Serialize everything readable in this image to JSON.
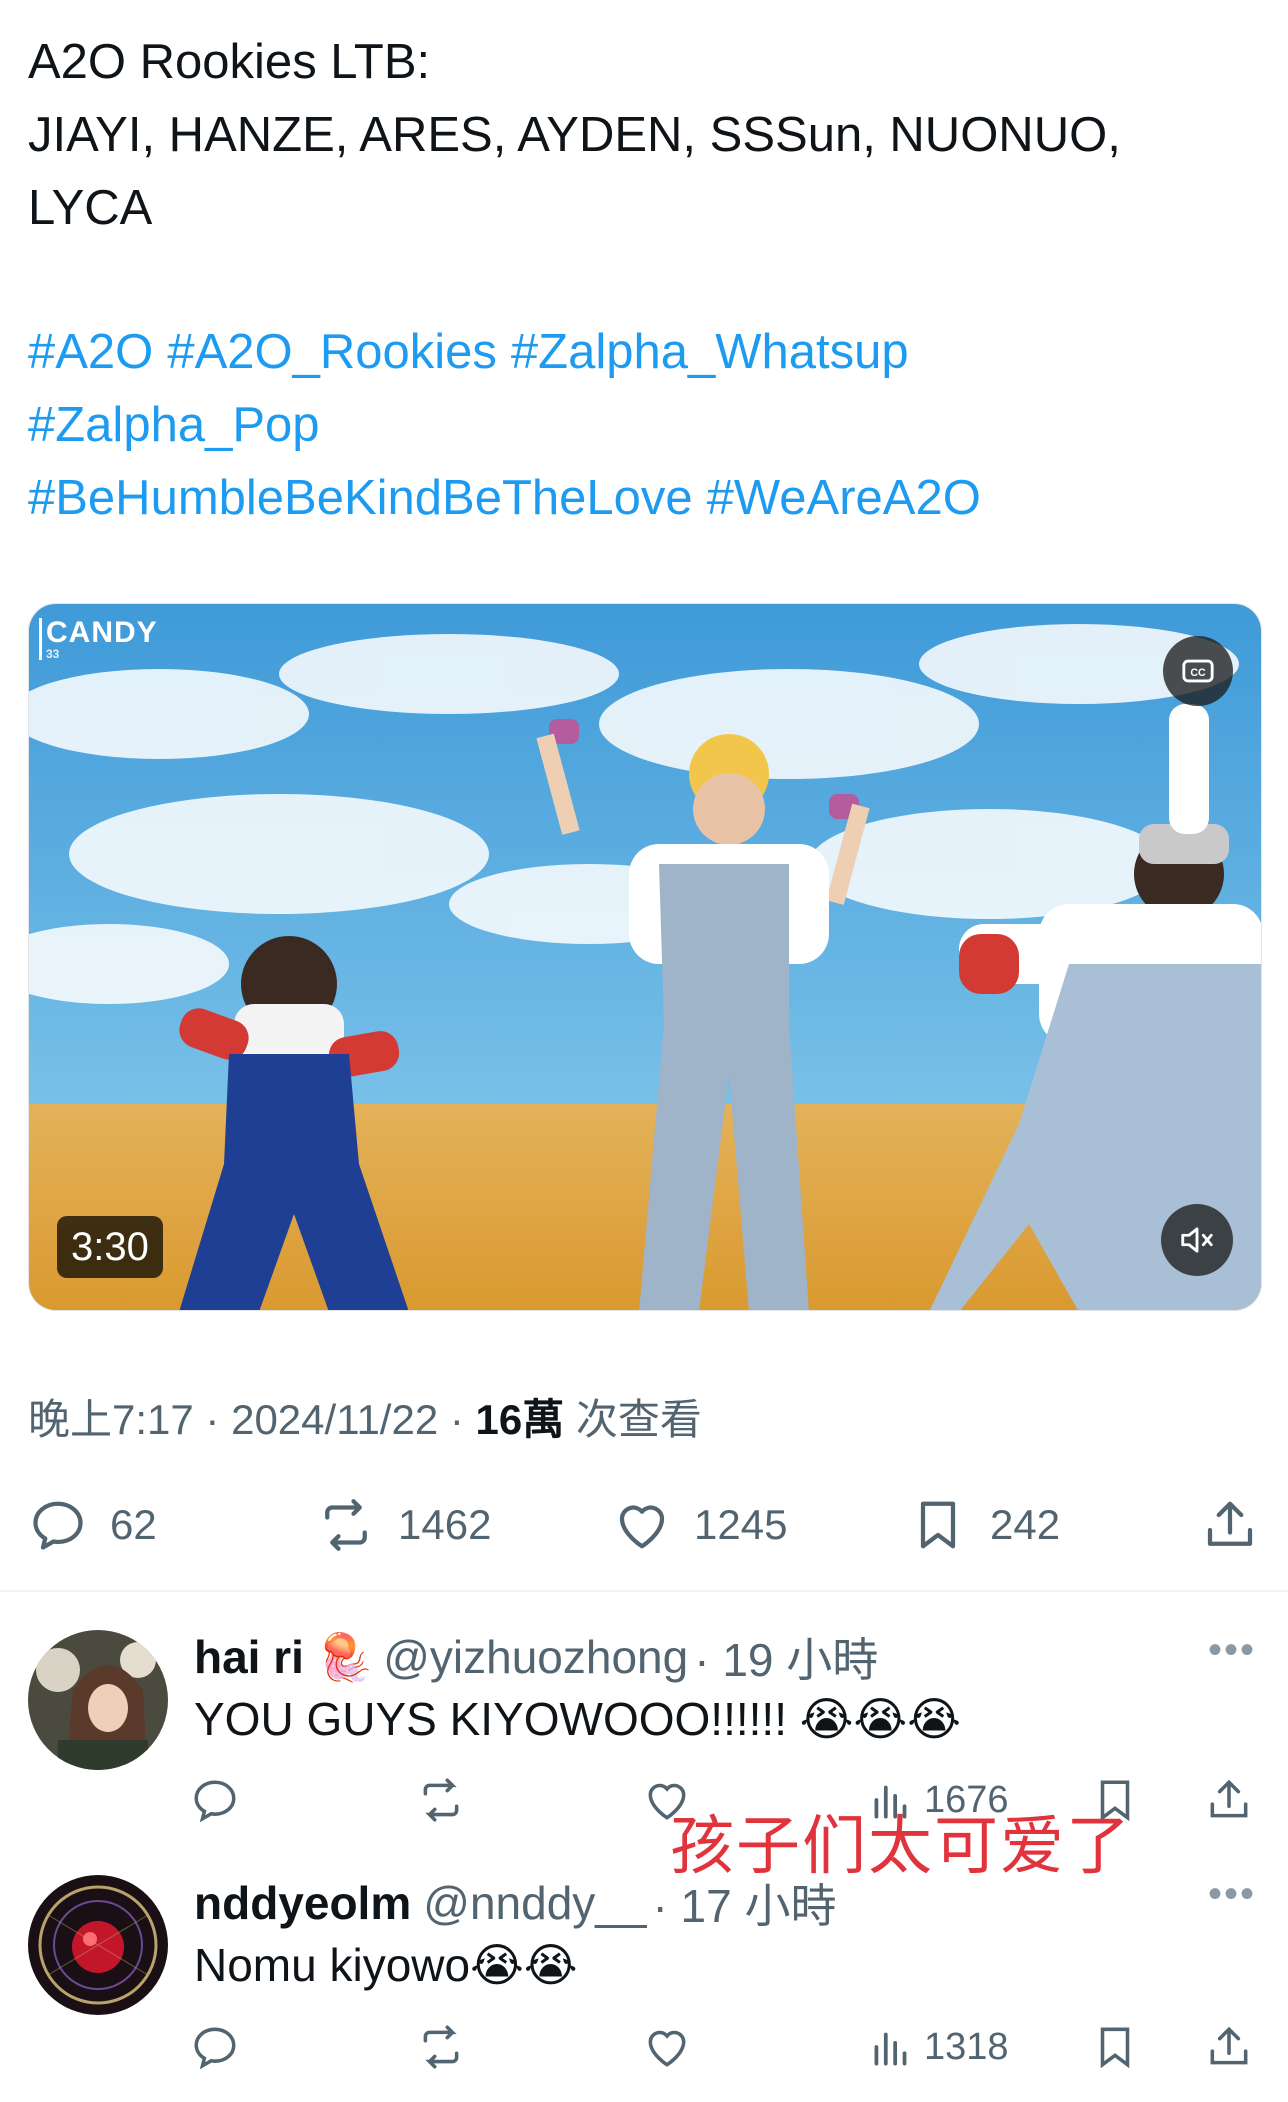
{
  "tweet": {
    "text_line1": "A2O Rookies LTB:",
    "text_line2": "JIAYI, HANZE, ARES, AYDEN, SSSun, NUONUO,",
    "text_line3": "LYCA",
    "hashtags_row1": [
      "#A2O",
      "#A2O_Rookies",
      "#Zalpha_Whatsup"
    ],
    "hashtags_row2": [
      "#Zalpha_Pop"
    ],
    "hashtags_row3": [
      "#BeHumbleBeKindBeTheLove",
      "#WeAreA2O"
    ]
  },
  "video": {
    "duration": "3:30",
    "channel_logo": "CANDY",
    "channel_logo_sub": "33"
  },
  "meta": {
    "time": "晚上7:17",
    "separator": "·",
    "date": "2024/11/22",
    "views": "16萬",
    "views_label": "次查看"
  },
  "actions": {
    "replies": "62",
    "retweets": "1462",
    "likes": "1245",
    "bookmarks": "242"
  },
  "replies": [
    {
      "name": "hai ri",
      "emoji": "🪼",
      "handle": "@yizhuozhong",
      "time": "· 19 小時",
      "text": "YOU GUYS KIYOWOOO!!!!!! 😭😭😭",
      "views": "1676"
    },
    {
      "name": "nddyeolm",
      "handle": "@nnddy__",
      "time": "· 17 小時",
      "text": "Nomu kiyowo😭😭",
      "views": "1318"
    }
  ],
  "overlay": {
    "text": "孩子们太可爱了"
  },
  "icons": {
    "reply": "reply-icon",
    "retweet": "retweet-icon",
    "like": "heart-icon",
    "bookmark": "bookmark-icon",
    "share": "share-icon",
    "views": "analytics-icon",
    "more": "more-icon",
    "cc": "captions-icon",
    "mute": "mute-icon"
  },
  "colors": {
    "link": "#1d9bf0",
    "secondary": "#536471",
    "overlay": "#e0333b"
  }
}
